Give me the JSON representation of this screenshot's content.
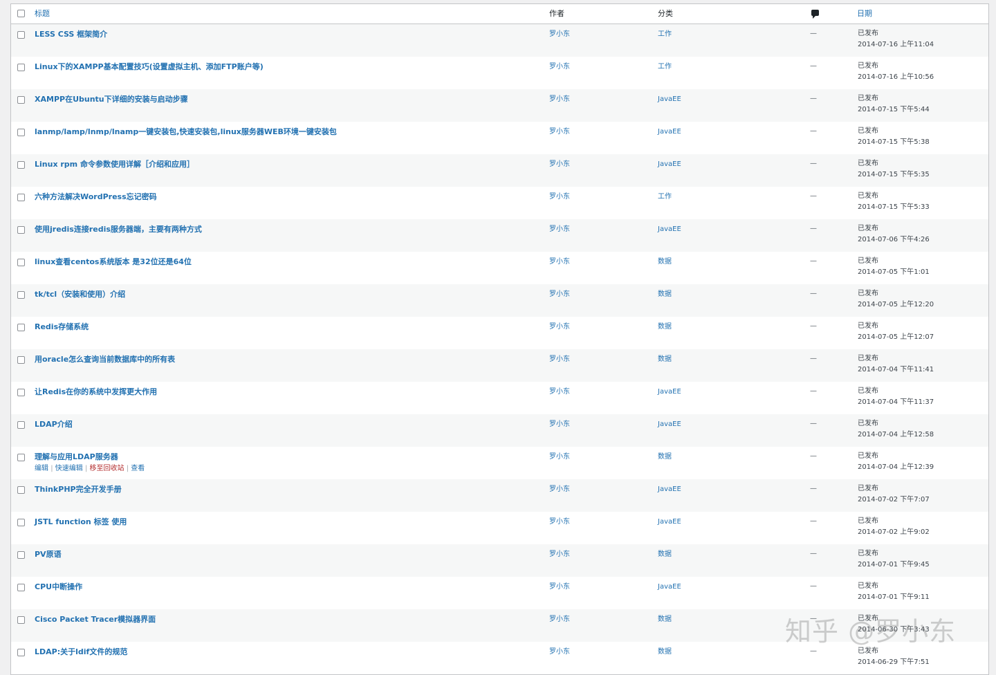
{
  "header": {
    "title": "标题",
    "author": "作者",
    "category": "分类",
    "comments_icon": "comment-bubble-icon",
    "date": "日期"
  },
  "rows": [
    {
      "title": "LESS CSS 框架简介",
      "author": "罗小东",
      "category": "工作",
      "comments": "—",
      "status": "已发布",
      "date": "2014-07-16 上午11:04"
    },
    {
      "title": "Linux下的XAMPP基本配置技巧(设置虚拟主机、添加FTP账户等)",
      "author": "罗小东",
      "category": "工作",
      "comments": "—",
      "status": "已发布",
      "date": "2014-07-16 上午10:56"
    },
    {
      "title": "XAMPP在Ubuntu下详细的安装与启动步骤",
      "author": "罗小东",
      "category": "JavaEE",
      "comments": "—",
      "status": "已发布",
      "date": "2014-07-15 下午5:44"
    },
    {
      "title": "lanmp/lamp/lnmp/lnamp一键安装包,快速安装包,linux服务器WEB环境一键安装包",
      "author": "罗小东",
      "category": "JavaEE",
      "comments": "—",
      "status": "已发布",
      "date": "2014-07-15 下午5:38"
    },
    {
      "title": "Linux rpm 命令参数使用详解［介绍和应用］",
      "author": "罗小东",
      "category": "JavaEE",
      "comments": "—",
      "status": "已发布",
      "date": "2014-07-15 下午5:35"
    },
    {
      "title": "六种方法解决WordPress忘记密码",
      "author": "罗小东",
      "category": "工作",
      "comments": "—",
      "status": "已发布",
      "date": "2014-07-15 下午5:33"
    },
    {
      "title": "使用jredis连接redis服务器端，主要有两种方式",
      "author": "罗小东",
      "category": "JavaEE",
      "comments": "—",
      "status": "已发布",
      "date": "2014-07-06 下午4:26"
    },
    {
      "title": "linux查看centos系统版本 是32位还是64位",
      "author": "罗小东",
      "category": "数据",
      "comments": "—",
      "status": "已发布",
      "date": "2014-07-05 下午1:01"
    },
    {
      "title": "tk/tcl（安装和使用）介绍",
      "author": "罗小东",
      "category": "数据",
      "comments": "—",
      "status": "已发布",
      "date": "2014-07-05 上午12:20"
    },
    {
      "title": "Redis存储系统",
      "author": "罗小东",
      "category": "数据",
      "comments": "—",
      "status": "已发布",
      "date": "2014-07-05 上午12:07"
    },
    {
      "title": "用oracle怎么查询当前数据库中的所有表",
      "author": "罗小东",
      "category": "数据",
      "comments": "—",
      "status": "已发布",
      "date": "2014-07-04 下午11:41"
    },
    {
      "title": "让Redis在你的系统中发挥更大作用",
      "author": "罗小东",
      "category": "JavaEE",
      "comments": "—",
      "status": "已发布",
      "date": "2014-07-04 下午11:37"
    },
    {
      "title": "LDAP介绍",
      "author": "罗小东",
      "category": "JavaEE",
      "comments": "—",
      "status": "已发布",
      "date": "2014-07-04 上午12:58"
    },
    {
      "title": "理解与应用LDAP服务器",
      "author": "罗小东",
      "category": "数据",
      "comments": "—",
      "status": "已发布",
      "date": "2014-07-04 上午12:39"
    },
    {
      "title": "ThinkPHP完全开发手册",
      "author": "罗小东",
      "category": "JavaEE",
      "comments": "—",
      "status": "已发布",
      "date": "2014-07-02 下午7:07"
    },
    {
      "title": "JSTL function 标签 使用",
      "author": "罗小东",
      "category": "JavaEE",
      "comments": "—",
      "status": "已发布",
      "date": "2014-07-02 上午9:02"
    },
    {
      "title": "PV原语",
      "author": "罗小东",
      "category": "数据",
      "comments": "—",
      "status": "已发布",
      "date": "2014-07-01 下午9:45"
    },
    {
      "title": "CPU中断操作",
      "author": "罗小东",
      "category": "JavaEE",
      "comments": "—",
      "status": "已发布",
      "date": "2014-07-01 下午9:11"
    },
    {
      "title": "Cisco Packet Tracer模拟器界面",
      "author": "罗小东",
      "category": "数据",
      "comments": "—",
      "status": "已发布",
      "date": "2014-06-30 下午3:43"
    },
    {
      "title": "LDAP:关于ldif文件的规范",
      "author": "罗小东",
      "category": "数据",
      "comments": "—",
      "status": "已发布",
      "date": "2014-06-29 下午7:51"
    }
  ],
  "row_actions": {
    "row_index": 13,
    "edit": "编辑",
    "quick_edit": "快速编辑",
    "trash": "移至回收站",
    "view": "查看",
    "sep": "|"
  },
  "watermark": "知乎 @罗小东",
  "colors": {
    "link": "#2271b1",
    "trash": "#b32d2e",
    "alt_row": "#f6f7f7"
  }
}
